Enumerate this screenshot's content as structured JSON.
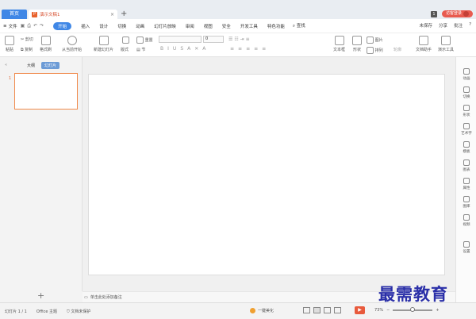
{
  "tabs": {
    "home": "首页",
    "document": "演示文稿1",
    "close": "×",
    "add": "+"
  },
  "titlebar_right": {
    "badge": "1",
    "login": "访客登录"
  },
  "menubar": {
    "file": "文件",
    "items": [
      "开始",
      "插入",
      "设计",
      "切换",
      "动画",
      "幻灯片放映",
      "审阅",
      "视图",
      "安全",
      "开发工具",
      "特色功能"
    ],
    "active_index": 0,
    "search": "查找",
    "right": [
      "未保存",
      "分享",
      "批注"
    ]
  },
  "ribbon": {
    "paste": "粘贴",
    "cut": "剪切",
    "copy": "复制",
    "format_painter": "格式刷",
    "play_from_current": "从当前开始",
    "new_slide": "新建幻灯片",
    "layout": "版式",
    "section": "节",
    "reset": "重置",
    "font_size": "0",
    "textbox": "文本框",
    "shape": "形状",
    "picture": "图片",
    "arrange": "排列",
    "outline": "轮廓",
    "doc_assistant": "文档助手",
    "presentation_tools": "演示工具"
  },
  "leftpanel": {
    "outline_tab": "大纲",
    "slides_tab": "幻灯片",
    "slide_number": "1",
    "add": "+"
  },
  "notes_placeholder": "单击此处添加备注",
  "rightbar": [
    "动画",
    "切换",
    "形状",
    "艺术字",
    "模板",
    "图表",
    "属性",
    "图库",
    "视频",
    "设置"
  ],
  "statusbar": {
    "slide_info": "幻灯片 1 / 1",
    "theme": "Office 主题",
    "doc_protect": "文档未保护",
    "beautify": "一键美化",
    "zoom": "73%",
    "minus": "−",
    "plus": "+"
  },
  "watermark": "最需教育",
  "colors": {
    "accent": "#3f87e6",
    "login": "#e85a4f",
    "thumb_border": "#f08a4b",
    "watermark": "#2a2fa8"
  }
}
